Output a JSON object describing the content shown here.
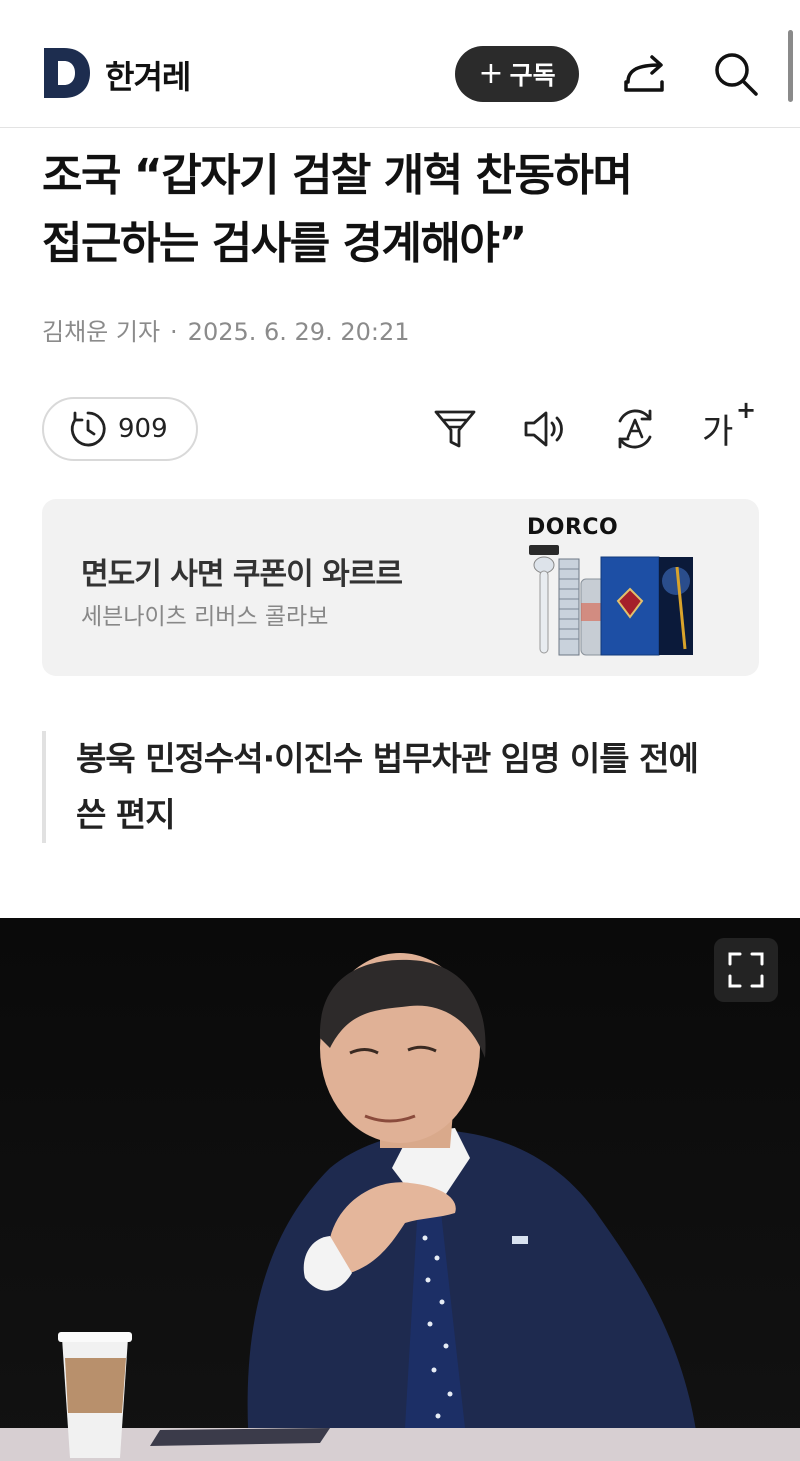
{
  "header": {
    "logo_letter": "D",
    "logo_text": "한겨레",
    "subscribe_label": "구독",
    "subscribe_plus": "+",
    "share_icon": "share-icon",
    "search_icon": "search-icon"
  },
  "article": {
    "headline_line1": "조국 “갑자기 검찰 개혁 찬동하며",
    "headline_line2": "접근하는 검사를 경계해야”",
    "author": "김채운 기자",
    "separator": "·",
    "datetime": "2025. 6. 29. 20:21",
    "subheading_line1": "봉욱 민정수석·이진수 법무차관 임명 이틀 전에",
    "subheading_line2": "쓴 편지"
  },
  "tools": {
    "views": "909",
    "icons": [
      "clock-icon",
      "filter-icon",
      "speaker-icon",
      "translate-icon",
      "font-size-icon"
    ],
    "font_size_label": "가"
  },
  "ad": {
    "title": "면도기 사면 쿠폰이 와르르",
    "subtitle": "세븐나이츠 리버스 콜라보",
    "brand": "DORCO"
  },
  "colors": {
    "accent": "#2b2b2b",
    "logo": "#1d2d4f",
    "muted_text": "#8b8b8b",
    "ad_background": "#f2f2f2"
  }
}
